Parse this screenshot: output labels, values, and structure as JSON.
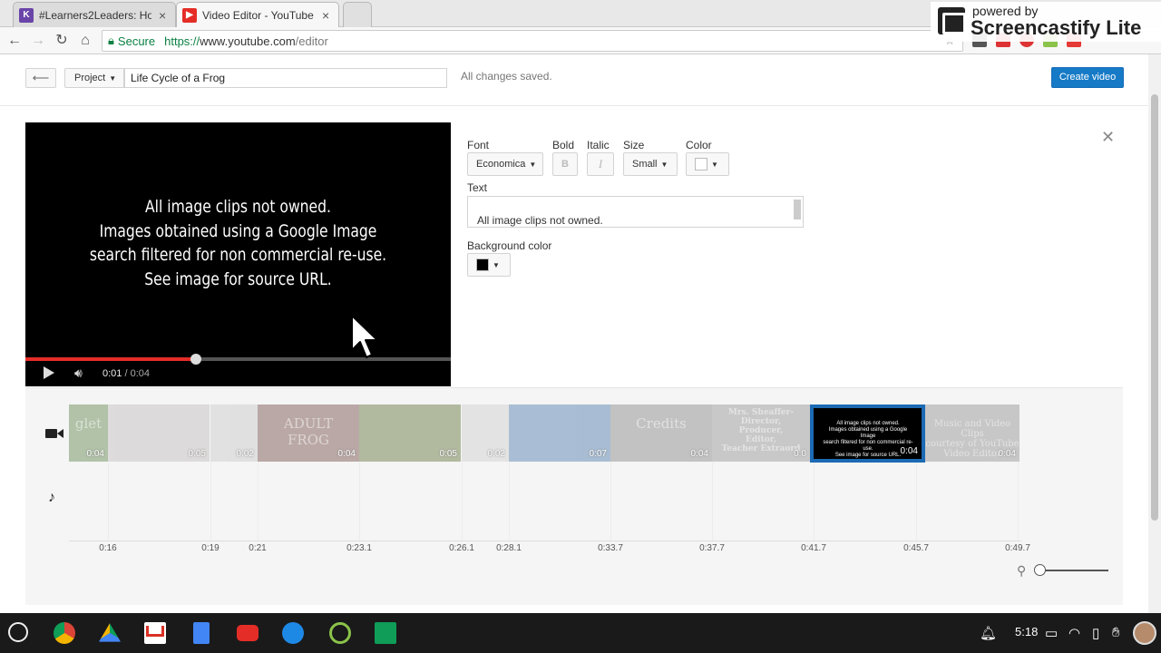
{
  "browser": {
    "tabs": [
      {
        "title": "#Learners2Leaders: How",
        "favicon": "k-icon",
        "favicon_letter": "K",
        "favicon_color": "#6a45a8",
        "active": false
      },
      {
        "title": "Video Editor - YouTube",
        "favicon": "youtube-icon",
        "favicon_color": "#e52d27",
        "active": true
      }
    ],
    "secure_label": "Secure",
    "url_proto": "https://",
    "url_host": "www.youtube.com",
    "url_path": "/editor"
  },
  "overlay": {
    "powered_by": "powered by",
    "brand": "Screencastify Lite"
  },
  "editor": {
    "project_label": "Project",
    "project_name": "Life Cycle of a Frog",
    "save_status": "All changes saved.",
    "create_label": "Create video"
  },
  "player": {
    "text": "All image clips not owned.\nImages obtained using a Google Image\nsearch filtered for non commercial re-use.\nSee image for source URL.",
    "current_time": "0:01",
    "total_time": "/ 0:04",
    "progress_fraction": 0.4
  },
  "properties": {
    "font_label": "Font",
    "font_value": "Economica",
    "bold_label": "Bold",
    "bold_glyph": "B",
    "italic_label": "Italic",
    "italic_glyph": "I",
    "size_label": "Size",
    "size_value": "Small",
    "color_label": "Color",
    "color_value": "#ffffff",
    "text_label": "Text",
    "text_value": "All image clips not owned.\nImages obtained using a Google Image",
    "bg_label": "Background color",
    "bg_value": "#000000"
  },
  "timeline": {
    "clips": [
      {
        "duration": "0:04",
        "color": "#7a9a6a",
        "art": "glet"
      },
      {
        "duration": "0:05",
        "color": "#c9c4c4",
        "art": ""
      },
      {
        "duration": "0:02",
        "color": "#cfcfcf",
        "art": ""
      },
      {
        "duration": "0:04",
        "color": "#8a6a66",
        "art": "ADULT\nFROG"
      },
      {
        "duration": "0:05",
        "color": "#7b8a5a",
        "art": ""
      },
      {
        "duration": "0:02",
        "color": "#d6d6d6",
        "art": ""
      },
      {
        "duration": "0:07",
        "color": "#6a90b8",
        "art": ""
      },
      {
        "duration": "0:04",
        "color": "#9a9a9a",
        "art": "Credits"
      },
      {
        "duration": "0:0",
        "color": "#a5a5a5",
        "art": "Mrs. Sheaffer-\nDirector,\nProducer,\nEditor,\nTeacher Extraord"
      },
      {
        "duration": "0:04",
        "color": "#a3a3a3",
        "art": "Music and Video Clips\ncourtesy of YouTube\nVideo Editor"
      }
    ],
    "selected_clip": {
      "duration": "0:04",
      "text": "All image clips not owned.\nImages obtained using a Google Image\nsearch filtered for non commercial re-use.\nSee image for source URL."
    },
    "ticks": [
      "0:16",
      "0:19",
      "0:21",
      "0:23.1",
      "0:26.1",
      "0:28.1",
      "0:33.7",
      "0:37.7",
      "0:41.7",
      "0:45.7",
      "0:49.7"
    ]
  },
  "shelf": {
    "time": "5:18",
    "apps": [
      "chrome-icon",
      "drive-icon",
      "gmail-icon",
      "docs-icon",
      "youtube-icon",
      "files-icon",
      "screencastify-icon",
      "classroom-icon"
    ]
  }
}
